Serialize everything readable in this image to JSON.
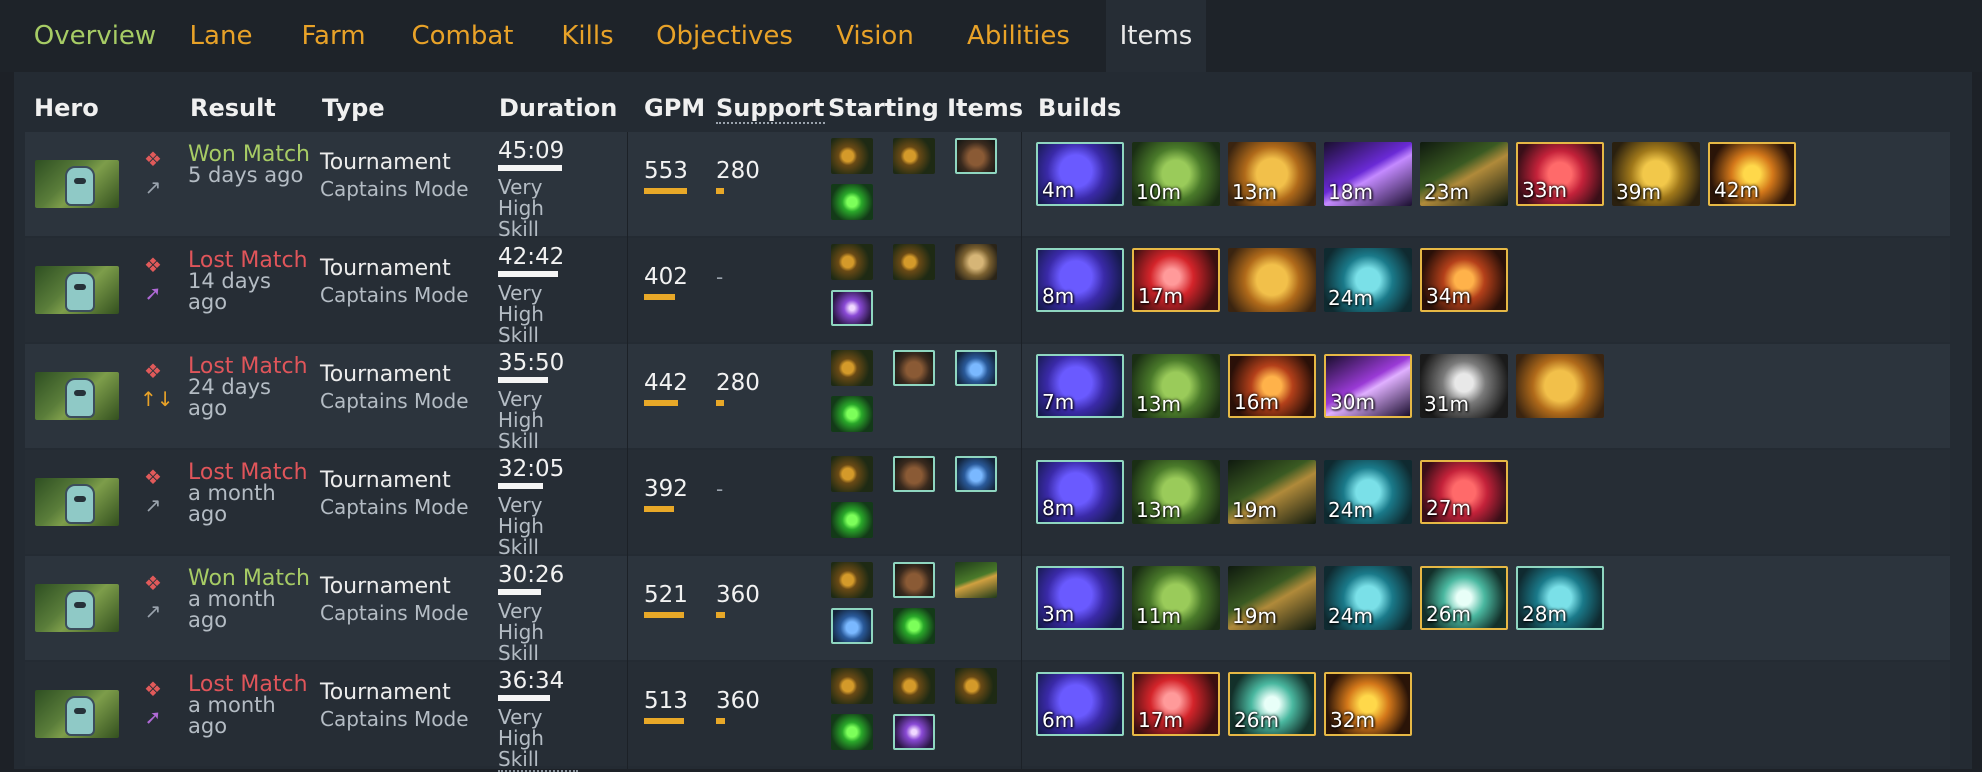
{
  "tabs": [
    "Overview",
    "Lane",
    "Farm",
    "Combat",
    "Kills",
    "Objectives",
    "Vision",
    "Abilities",
    "Items"
  ],
  "active_tab": "Items",
  "headers": {
    "hero": "Hero",
    "result": "Result",
    "type": "Type",
    "duration": "Duration",
    "gpm": "GPM",
    "support": "Support",
    "starting_items": "Starting Items",
    "builds": "Builds"
  },
  "accent_colors": {
    "win": "#a7cc65",
    "loss": "#e0555a",
    "tab": "#e8a228",
    "bar": "#e8a828"
  },
  "rows": [
    {
      "result": "Won Match",
      "outcome": "win",
      "ago": "5 days ago",
      "type": "Tournament",
      "mode": "Captains Mode",
      "duration": "45:09",
      "duration_pct": 0.86,
      "skill": "Very High Skill",
      "gpm": "553",
      "gpm_pct": 0.76,
      "support": "280",
      "support_pct": 0.17,
      "role_icon": "chain-icon",
      "starting": [
        "claw-icon",
        "claw-icon",
        "boots-icon",
        "green-orb-icon"
      ],
      "builds": [
        "4m",
        "10m",
        "13m",
        "18m",
        "23m",
        "33m",
        "39m",
        "42m"
      ]
    },
    {
      "result": "Lost Match",
      "outcome": "loss",
      "ago": "14 days ago",
      "type": "Tournament",
      "mode": "Captains Mode",
      "duration": "42:42",
      "duration_pct": 0.81,
      "skill": "Very High Skill",
      "gpm": "402",
      "gpm_pct": 0.55,
      "support": "-",
      "support_pct": 0,
      "role_icon": "purple-sword-icon",
      "starting": [
        "claw-icon",
        "claw-icon",
        "scroll-icon",
        "purple-ward-icon"
      ],
      "builds": [
        "8m",
        "17m",
        "",
        "24m",
        "34m"
      ]
    },
    {
      "result": "Lost Match",
      "outcome": "loss",
      "ago": "24 days ago",
      "type": "Tournament",
      "mode": "Captains Mode",
      "duration": "35:50",
      "duration_pct": 0.68,
      "skill": "Very High Skill",
      "gpm": "442",
      "gpm_pct": 0.61,
      "support": "280",
      "support_pct": 0.17,
      "role_icon": "arrows-icon",
      "starting": [
        "claw-icon",
        "boots-icon",
        "potion-icon",
        "green-orb-icon"
      ],
      "builds": [
        "7m",
        "13m",
        "16m",
        "30m",
        "31m",
        ""
      ]
    },
    {
      "result": "Lost Match",
      "outcome": "loss",
      "ago": "a month ago",
      "type": "Tournament",
      "mode": "Captains Mode",
      "duration": "32:05",
      "duration_pct": 0.61,
      "skill": "Very High Skill",
      "gpm": "392",
      "gpm_pct": 0.54,
      "support": "-",
      "support_pct": 0,
      "role_icon": "chain-icon",
      "starting": [
        "claw-icon",
        "boots-icon",
        "potion-icon",
        "green-orb-icon"
      ],
      "builds": [
        "8m",
        "13m",
        "19m",
        "24m",
        "27m"
      ]
    },
    {
      "result": "Won Match",
      "outcome": "win",
      "ago": "a month ago",
      "type": "Tournament",
      "mode": "Captains Mode",
      "duration": "30:26",
      "duration_pct": 0.58,
      "skill": "Very High Skill",
      "gpm": "521",
      "gpm_pct": 0.72,
      "support": "360",
      "support_pct": 0.2,
      "role_icon": "chain-icon",
      "starting": [
        "claw-icon",
        "boots-icon",
        "branch-icon",
        "potion-icon",
        "green-orb-icon"
      ],
      "builds": [
        "3m",
        "11m",
        "19m",
        "24m",
        "26m",
        "28m"
      ]
    },
    {
      "result": "Lost Match",
      "outcome": "loss",
      "ago": "a month ago",
      "type": "Tournament",
      "mode": "Captains Mode",
      "duration": "36:34",
      "duration_pct": 0.7,
      "skill": "Very High Skill",
      "gpm": "513",
      "gpm_pct": 0.71,
      "support": "360",
      "support_pct": 0.2,
      "role_icon": "purple-sword-icon",
      "starting": [
        "claw-icon",
        "claw-icon",
        "claw-icon",
        "green-orb-icon",
        "purple-ward-icon"
      ],
      "builds": [
        "6m",
        "17m",
        "26m",
        "32m"
      ]
    }
  ]
}
